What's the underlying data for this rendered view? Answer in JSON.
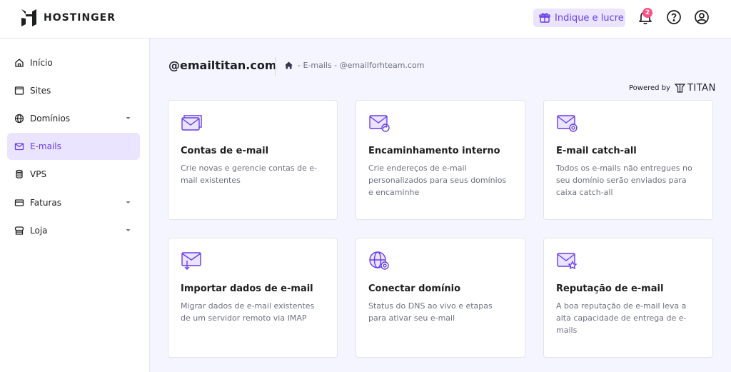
{
  "brand": {
    "name": "HOSTINGER"
  },
  "topbar": {
    "refer_label": "Indique e lucre",
    "notification_count": "2"
  },
  "sidebar": {
    "items": [
      {
        "label": "Início",
        "icon": "home-icon"
      },
      {
        "label": "Sites",
        "icon": "browser-icon"
      },
      {
        "label": "Domínios",
        "icon": "globe-icon"
      },
      {
        "label": "E-mails",
        "icon": "mail-icon",
        "active": true
      },
      {
        "label": "VPS",
        "icon": "database-icon"
      },
      {
        "label": "Faturas",
        "icon": "credit-card-icon"
      },
      {
        "label": "Loja",
        "icon": "store-icon"
      }
    ]
  },
  "page": {
    "title": "@emailtitan.com",
    "breadcrumb": "- E-mails - @emailforhteam.com",
    "powered_by": "Powered by",
    "powered_brand": "TITAN"
  },
  "cards": [
    {
      "title": "Contas de e-mail",
      "description": "Crie novas e gerencie contas de e-mail existentes"
    },
    {
      "title": "Encaminhamento interno",
      "description": "Crie endereços de e-mail personalizados para seus domínios e encaminhe"
    },
    {
      "title": "E-mail catch-all",
      "description": "Todos os e-mails não entregues no seu domínio serão enviados para caixa catch-all"
    },
    {
      "title": "Importar dados de e-mail",
      "description": "Migrar dados de e-mail existentes de um servidor remoto via IMAP"
    },
    {
      "title": "Conectar domínio",
      "description": "Status do DNS ao vivo e etapas para ativar seu e-mail"
    },
    {
      "title": "Reputação de e-mail",
      "description": "A boa reputação de e-mail leva a alta capacidade de entrega de e-mails"
    }
  ],
  "colors": {
    "accent": "#673de6",
    "accent_light": "#ebe4ff",
    "badge": "#fc5185"
  }
}
